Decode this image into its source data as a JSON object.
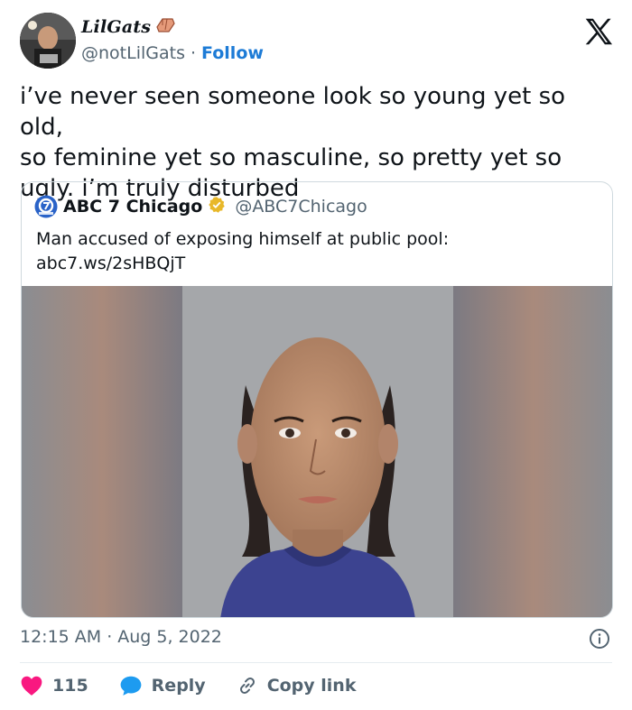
{
  "author": {
    "display_name": "LilGats",
    "handle": "@notLilGats",
    "separator": "·",
    "follow_label": "Follow"
  },
  "tweet": {
    "text": "i’ve never seen someone look so young yet so old,\nso feminine yet so masculine, so pretty yet so\nugly. i’m truly disturbed"
  },
  "quoted": {
    "name": "ABC 7 Chicago",
    "handle": "@ABC7Chicago",
    "text": "Man accused of exposing himself at public pool:",
    "link": "abc7.ws/2sHBQjT"
  },
  "meta": {
    "time": "12:15 AM",
    "separator": "·",
    "date": "Aug 5, 2022"
  },
  "actions": {
    "likes": "115",
    "reply_label": "Reply",
    "copy_label": "Copy link"
  },
  "icons": {
    "brand": "x-logo-icon",
    "verified": "verified-badge-icon",
    "like": "heart-icon",
    "reply": "reply-bubble-icon",
    "copy": "link-icon",
    "info": "info-icon"
  },
  "colors": {
    "link_blue": "#1d7bd6",
    "like_red": "#f91880",
    "reply_blue": "#1d9bf0",
    "verified_gold": "#e8b829",
    "muted": "#536471",
    "abc_blue": "#2a63c8"
  }
}
